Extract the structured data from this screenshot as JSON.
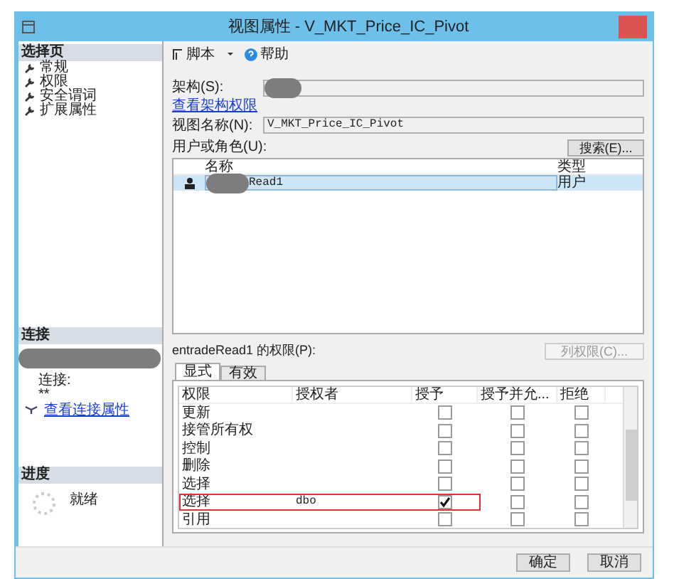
{
  "window": {
    "title": "视图属性 - V_MKT_Price_IC_Pivot"
  },
  "sidebar": {
    "header": "选择页",
    "pages": [
      {
        "label": "常规"
      },
      {
        "label": "权限"
      },
      {
        "label": "安全谓词"
      },
      {
        "label": "扩展属性"
      }
    ]
  },
  "connection": {
    "header": "连接",
    "redacted": true,
    "label": "连接:",
    "value": "**",
    "link": "查看连接属性"
  },
  "progress": {
    "header": "进度",
    "status": "就绪"
  },
  "toolbar": {
    "script": "脚本",
    "help": "帮助"
  },
  "schema": {
    "label": "架构(S):",
    "redacted": true
  },
  "schema_link": "查看架构权限",
  "view_name": {
    "label": "视图名称(N):",
    "value": "V_MKT_Price_IC_Pivot"
  },
  "users": {
    "label": "用户或角色(U):",
    "search_button": "搜索(E)...",
    "columns": [
      "名称",
      "类型"
    ],
    "rows": [
      {
        "name": "Read1",
        "type": "用户",
        "selected": true,
        "redacted": true
      }
    ]
  },
  "permissions": {
    "label": "entradeRead1 的权限(P):",
    "column_button": {
      "label": "列权限(C)...",
      "disabled": true
    },
    "tabs": [
      {
        "label": "显式",
        "selected": true
      },
      {
        "label": "有效",
        "selected": false
      }
    ],
    "columns": [
      "权限",
      "授权者",
      "授予",
      "授予并允...",
      "拒绝"
    ],
    "rows": [
      {
        "permission": "更新",
        "grant": false,
        "with_grant": false,
        "deny": false,
        "highlighted": false
      },
      {
        "permission": "接管所有权",
        "grant": false,
        "with_grant": false,
        "deny": false,
        "highlighted": false
      },
      {
        "permission": "控制",
        "grant": false,
        "with_grant": false,
        "deny": false,
        "highlighted": false
      },
      {
        "permission": "删除",
        "grant": false,
        "with_grant": false,
        "deny": false,
        "highlighted": false
      },
      {
        "permission": "选择",
        "grant": false,
        "with_grant": false,
        "deny": false,
        "highlighted": false
      },
      {
        "permission": "选择",
        "grantor": "dbo",
        "grant": true,
        "with_grant": false,
        "deny": false,
        "highlighted": true
      },
      {
        "permission": "引用",
        "grant": false,
        "with_grant": false,
        "deny": false,
        "highlighted": false
      }
    ]
  },
  "buttons": [
    {
      "label": "确定"
    },
    {
      "label": "取消"
    }
  ]
}
